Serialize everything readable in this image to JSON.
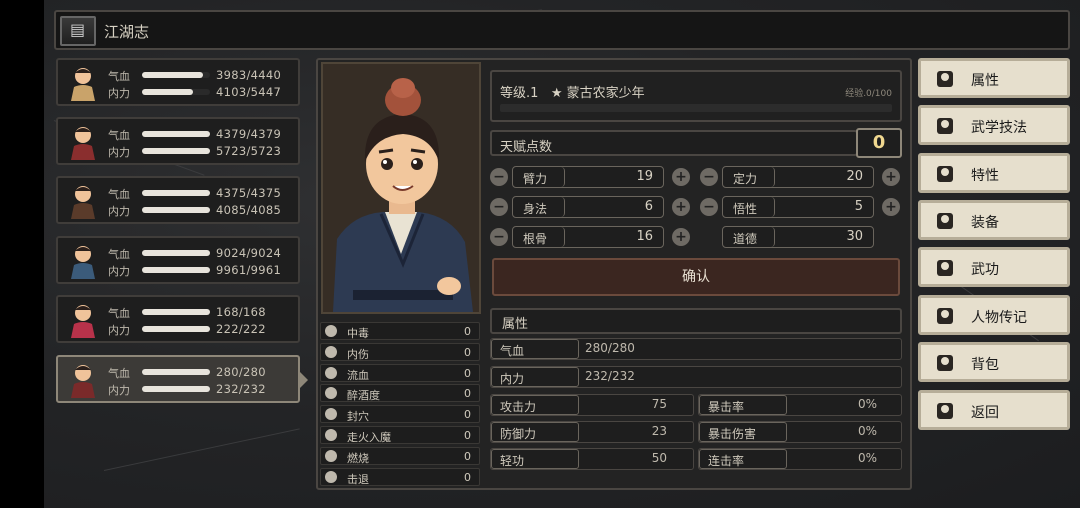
{
  "header": {
    "title": "江湖志"
  },
  "party": [
    {
      "hp_label": "气血",
      "mp_label": "内力",
      "hp": "3983/4440",
      "mp": "4103/5447",
      "hp_frac": 0.897,
      "mp_frac": 0.753,
      "selected": false
    },
    {
      "hp_label": "气血",
      "mp_label": "内力",
      "hp": "4379/4379",
      "mp": "5723/5723",
      "hp_frac": 1,
      "mp_frac": 1,
      "selected": false
    },
    {
      "hp_label": "气血",
      "mp_label": "内力",
      "hp": "4375/4375",
      "mp": "4085/4085",
      "hp_frac": 1,
      "mp_frac": 1,
      "selected": false
    },
    {
      "hp_label": "气血",
      "mp_label": "内力",
      "hp": "9024/9024",
      "mp": "9961/9961",
      "hp_frac": 1,
      "mp_frac": 1,
      "selected": false
    },
    {
      "hp_label": "气血",
      "mp_label": "内力",
      "hp": "168/168",
      "mp": "222/222",
      "hp_frac": 1,
      "mp_frac": 1,
      "selected": false
    },
    {
      "hp_label": "气血",
      "mp_label": "内力",
      "hp": "280/280",
      "mp": "232/232",
      "hp_frac": 1,
      "mp_frac": 1,
      "selected": true
    }
  ],
  "status_effects": [
    {
      "name": "中毒",
      "value": "0"
    },
    {
      "name": "内伤",
      "value": "0"
    },
    {
      "name": "流血",
      "value": "0"
    },
    {
      "name": "醉酒度",
      "value": "0"
    },
    {
      "name": "封穴",
      "value": "0"
    },
    {
      "name": "走火入魔",
      "value": "0"
    },
    {
      "name": "燃烧",
      "value": "0"
    },
    {
      "name": "击退",
      "value": "0"
    }
  ],
  "level": {
    "text": "等级.1",
    "title": "★ 蒙古农家少年",
    "exp": "经验.0/100",
    "exp_frac": 0
  },
  "talent": {
    "label": "天赋点数",
    "value": "0"
  },
  "attributes": [
    {
      "name": "臂力",
      "value": "19"
    },
    {
      "name": "定力",
      "value": "20"
    },
    {
      "name": "身法",
      "value": "6"
    },
    {
      "name": "悟性",
      "value": "5"
    },
    {
      "name": "根骨",
      "value": "16"
    },
    {
      "name": "道德",
      "value": "30"
    }
  ],
  "confirm_label": "确认",
  "section_label": "属性",
  "stats": {
    "hp": {
      "label": "气血",
      "value": "280/280"
    },
    "mp": {
      "label": "内力",
      "value": "232/232"
    },
    "attack": {
      "label": "攻击力",
      "value": "75"
    },
    "crit_rate": {
      "label": "暴击率",
      "value": "0%"
    },
    "defense": {
      "label": "防御力",
      "value": "23"
    },
    "crit_dmg": {
      "label": "暴击伤害",
      "value": "0%"
    },
    "qinggong": {
      "label": "轻功",
      "value": "50"
    },
    "combo": {
      "label": "连击率",
      "value": "0%"
    }
  },
  "menu": [
    {
      "label": "属性",
      "icon": "person-icon"
    },
    {
      "label": "武学技法",
      "icon": "martial-person-icon"
    },
    {
      "label": "特性",
      "icon": "trait-person-icon"
    },
    {
      "label": "装备",
      "icon": "sword-icon"
    },
    {
      "label": "武功",
      "icon": "manual-icon"
    },
    {
      "label": "人物传记",
      "icon": "scroll-icon"
    },
    {
      "label": "背包",
      "icon": "bag-icon"
    },
    {
      "label": "返回",
      "icon": "door-icon"
    }
  ]
}
